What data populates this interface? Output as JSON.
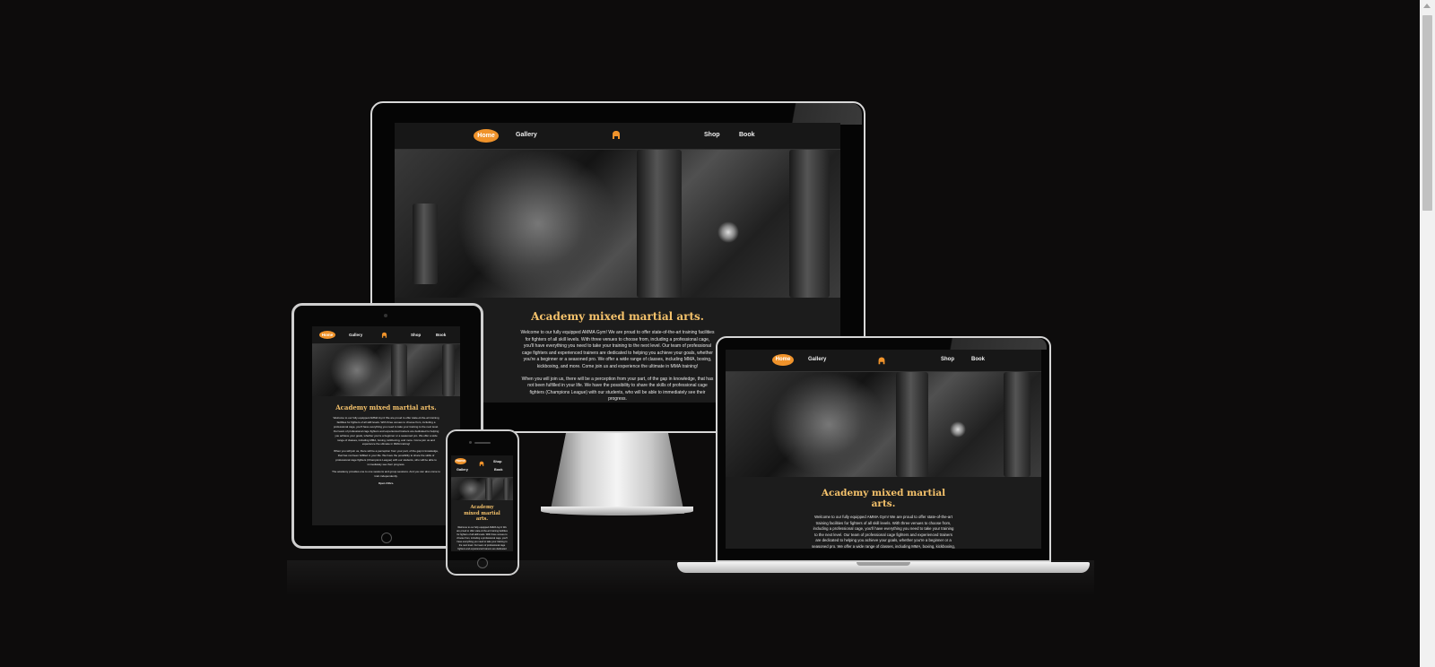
{
  "site": {
    "nav": {
      "home": "Home",
      "gallery": "Gallery",
      "shop": "Shop",
      "book": "Book",
      "logo_icon": "gorilla-icon"
    },
    "heading": "Academy mixed martial arts.",
    "heading_phone": "Academy mixed martial arts.",
    "para1": "Welcome to our fully equipped AMMA Gym! We are proud to offer state-of-the-art training facilities for fighters of all skill levels. With three venues to choose from, including a professional cage, you'll have everything you need to take your training to the next level. Our team of professional cage fighters and experienced trainers are dedicated to helping you achieve your goals, whether you're a beginner or a seasoned pro. We offer a wide range of classes, including MMA, boxing, kickboxing, and more. Come join us and experience the ultimate in MMA training!",
    "para2": "When you will join us, there will be a perception from your part, of the gap in knowledge, that has not been fulfilled in your life. We have the possibility to share the skills of professional cage fighters (Champions League) with our students, who will be able to immediately see their progress.",
    "para3": "The academy provides one to one sessions and group sessions. And you can also come to train independently.",
    "para4": "Open 24hrs."
  },
  "colors": {
    "background": "#0d0c0c",
    "accent": "#f0932b",
    "heading": "#f5c26b"
  }
}
